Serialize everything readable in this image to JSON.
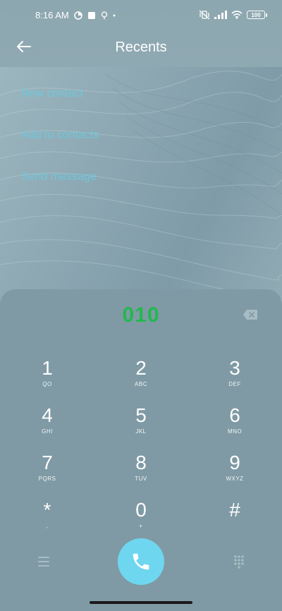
{
  "status": {
    "time": "8:16 AM",
    "battery": "100"
  },
  "header": {
    "title": "Recents"
  },
  "menu": {
    "items": [
      {
        "label": "New contact"
      },
      {
        "label": "Add to contacts"
      },
      {
        "label": "Send message"
      }
    ]
  },
  "dialer": {
    "number": "010",
    "number_color": "#22b84e",
    "keys": [
      {
        "digit": "1",
        "letters": "QO"
      },
      {
        "digit": "2",
        "letters": "ABC"
      },
      {
        "digit": "3",
        "letters": "DEF"
      },
      {
        "digit": "4",
        "letters": "GHI"
      },
      {
        "digit": "5",
        "letters": "JKL"
      },
      {
        "digit": "6",
        "letters": "MNO"
      },
      {
        "digit": "7",
        "letters": "PQRS"
      },
      {
        "digit": "8",
        "letters": "TUV"
      },
      {
        "digit": "9",
        "letters": "WXYZ"
      },
      {
        "digit": "*",
        "letters": ","
      },
      {
        "digit": "0",
        "letters": "+"
      },
      {
        "digit": "#",
        "letters": ""
      }
    ],
    "call_color": "#6fd6f0"
  },
  "icons": {
    "back": "arrow-left-icon",
    "backspace": "backspace-icon",
    "menu": "hamburger-menu-icon",
    "keypad": "dialpad-icon",
    "call": "phone-icon"
  }
}
